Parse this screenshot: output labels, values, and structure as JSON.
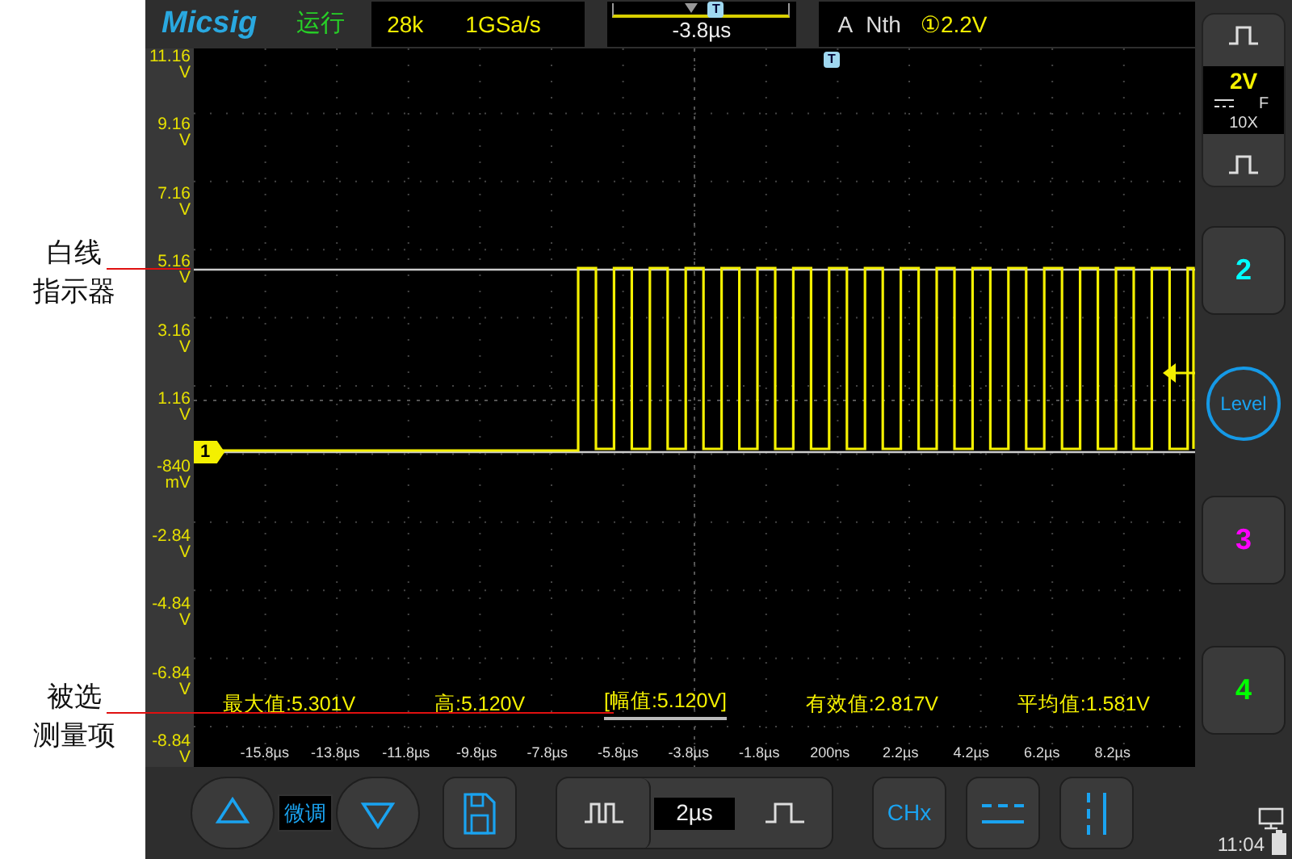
{
  "annotations": [
    {
      "lines": [
        "白线",
        "指示器"
      ]
    },
    {
      "lines": [
        "被选",
        "测量项"
      ]
    }
  ],
  "top_bar": {
    "logo": "Micsig",
    "run_state": "运行",
    "memory_depth": "28k",
    "sample_rate": "1GSa/s",
    "position_marker": "T",
    "trigger_position": "-3.8µs",
    "trigger": {
      "mode": "A",
      "type": "Nth",
      "setting": "①2.2V"
    }
  },
  "y_axis": [
    {
      "value": "11.16",
      "unit": "V"
    },
    {
      "value": "9.16",
      "unit": "V"
    },
    {
      "value": "7.16",
      "unit": "V"
    },
    {
      "value": "5.16",
      "unit": "V"
    },
    {
      "value": "3.16",
      "unit": "V"
    },
    {
      "value": "1.16",
      "unit": "V"
    },
    {
      "value": "-840",
      "unit": "mV"
    },
    {
      "value": "-2.84",
      "unit": "V"
    },
    {
      "value": "-4.84",
      "unit": "V"
    },
    {
      "value": "-6.84",
      "unit": "V"
    },
    {
      "value": "-8.84",
      "unit": "V"
    }
  ],
  "trigger_marker": "T",
  "channel_marker": "1",
  "measurements": [
    {
      "text": "最大值:5.301V",
      "selected": false
    },
    {
      "text": "高:5.120V",
      "selected": false
    },
    {
      "text": "[幅值:5.120V]",
      "selected": true
    },
    {
      "text": "有效值:2.817V",
      "selected": false
    },
    {
      "text": "平均值:1.581V",
      "selected": false
    }
  ],
  "x_axis": [
    "-15.8µs",
    "-13.8µs",
    "-11.8µs",
    "-9.8µs",
    "-7.8µs",
    "-5.8µs",
    "-3.8µs",
    "-1.8µs",
    "200ns",
    "2.2µs",
    "4.2µs",
    "6.2µs",
    "8.2µs"
  ],
  "channel_1": {
    "scale": "2V",
    "bandwidth": "F",
    "probe": "10X"
  },
  "channel_buttons": [
    {
      "label": "2",
      "color": "#00ffff"
    },
    {
      "label": "3",
      "color": "#ff00ff"
    },
    {
      "label": "4",
      "color": "#00ff00"
    }
  ],
  "level_knob": "Level",
  "bottom_bar": {
    "fine_adjust": "微调",
    "timebase": "2µs",
    "channel_button": "CHx"
  },
  "status": {
    "time": "11:04"
  }
}
